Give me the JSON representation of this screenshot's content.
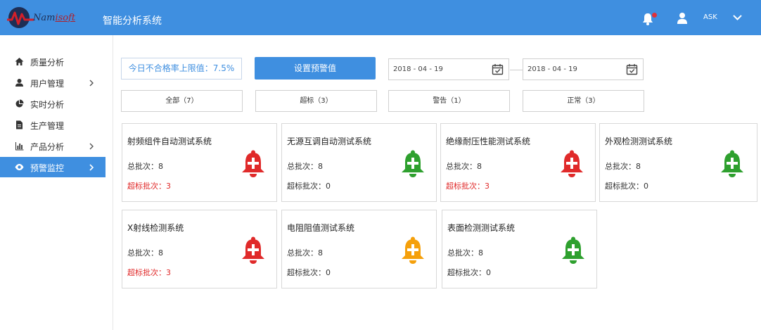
{
  "header": {
    "logo_text_a": "Nam",
    "logo_text_b": "isoft",
    "app_title": "智能分析系统",
    "user_name": "ASK"
  },
  "sidebar": {
    "items": [
      {
        "label": "质量分析",
        "icon": "home-icon",
        "has_chevron": false,
        "active": false
      },
      {
        "label": "用户管理",
        "icon": "user-icon",
        "has_chevron": true,
        "active": false
      },
      {
        "label": "实时分析",
        "icon": "pie-chart-icon",
        "has_chevron": false,
        "active": false
      },
      {
        "label": "生产管理",
        "icon": "document-icon",
        "has_chevron": false,
        "active": false
      },
      {
        "label": "产品分析",
        "icon": "bar-chart-icon",
        "has_chevron": true,
        "active": false
      },
      {
        "label": "预警监控",
        "icon": "eye-icon",
        "has_chevron": true,
        "active": true
      }
    ]
  },
  "toolbar": {
    "threshold_label": "今日不合格率上限值：7.5%",
    "set_button": "设置预警值",
    "date_from": "2018 - 04 - 19",
    "date_to": "2018 - 04 - 19"
  },
  "filters": [
    {
      "label": "全部（7）"
    },
    {
      "label": "超标（3）"
    },
    {
      "label": "警告（1）"
    },
    {
      "label": "正常（3）"
    }
  ],
  "colors": {
    "accent": "#3f8fe0",
    "danger": "#e02a2a",
    "warning": "#f5a00b",
    "normal": "#2ea02e"
  },
  "cards": [
    {
      "title": "射频组件自动测试系统",
      "total": "总批次：8",
      "over": "超标批次：3",
      "status": "danger"
    },
    {
      "title": "无源互调自动测试系统",
      "total": "总批次：8",
      "over": "超标批次：0",
      "status": "normal"
    },
    {
      "title": "绝缘耐压性能测试系统",
      "total": "总批次：8",
      "over": "超标批次：3",
      "status": "danger"
    },
    {
      "title": "外观检测测试系统",
      "total": "总批次：8",
      "over": "超标批次：0",
      "status": "normal"
    },
    {
      "title": "X射线检测系统",
      "total": "总批次：8",
      "over": "超标批次：3",
      "status": "danger"
    },
    {
      "title": "电阻阻值测试系统",
      "total": "总批次：8",
      "over": "超标批次：0",
      "status": "warning"
    },
    {
      "title": "表面检测测试系统",
      "total": "总批次：8",
      "over": "超标批次：0",
      "status": "normal"
    }
  ]
}
